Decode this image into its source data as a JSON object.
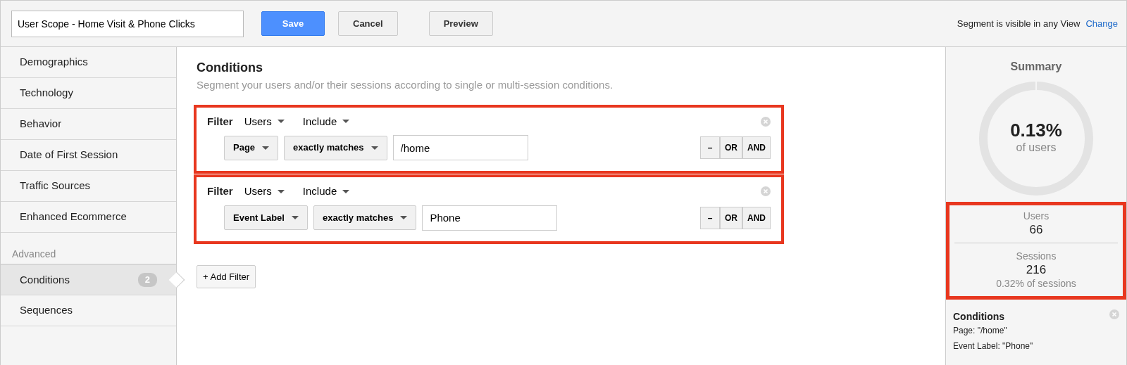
{
  "toolbar": {
    "segment_name": "User Scope - Home Visit & Phone Clicks",
    "buttons": [
      {
        "label": "Save",
        "kind": "primary"
      },
      {
        "label": "Cancel",
        "kind": "default"
      },
      {
        "label": "Preview",
        "kind": "default"
      }
    ],
    "visibility_text": "Segment is visible in any View",
    "visibility_link": "Change"
  },
  "sidebar": {
    "items": [
      {
        "label": "Demographics",
        "selected": false
      },
      {
        "label": "Technology",
        "selected": false
      },
      {
        "label": "Behavior",
        "selected": false
      },
      {
        "label": "Date of First Session",
        "selected": false
      },
      {
        "label": "Traffic Sources",
        "selected": false
      },
      {
        "label": "Enhanced Ecommerce",
        "selected": false
      }
    ],
    "advanced_heading": "Advanced",
    "advanced_items": [
      {
        "label": "Conditions",
        "selected": true,
        "count": "2"
      },
      {
        "label": "Sequences",
        "selected": false
      }
    ]
  },
  "main": {
    "title": "Conditions",
    "subtitle": "Segment your users and/or their sessions according to single or multi-session conditions.",
    "filters": [
      {
        "label": "Filter",
        "scope": "Users",
        "mode": "Include",
        "dimension": "Page",
        "operator": "exactly matches",
        "value": "/home",
        "highlighted": true,
        "actions": [
          "–",
          "OR",
          "AND"
        ]
      },
      {
        "label": "Filter",
        "scope": "Users",
        "mode": "Include",
        "dimension": "Event Label",
        "operator": "exactly matches",
        "value": "Phone",
        "highlighted": true,
        "actions": [
          "–",
          "OR",
          "AND"
        ]
      }
    ],
    "add_button": "+ Add Filter"
  },
  "summary": {
    "title": "Summary",
    "percent": "0.13%",
    "percent_label": "of users",
    "highlighted": true,
    "stats": [
      {
        "label": "Users",
        "value": "66"
      },
      {
        "label": "Sessions",
        "value": "216",
        "note": "0.32% of sessions"
      }
    ],
    "conditions_title": "Conditions",
    "conditions": [
      "Page: \"/home\"",
      "Event Label: \"Phone\""
    ]
  }
}
